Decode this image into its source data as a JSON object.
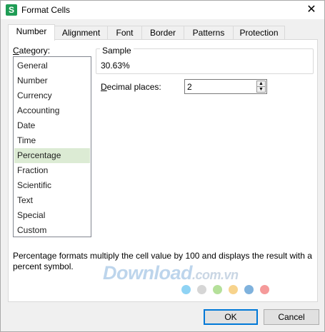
{
  "window": {
    "title": "Format Cells",
    "close_glyph": "✕",
    "app_icon_letter": "S"
  },
  "tabs": [
    {
      "label": "Number",
      "active": true
    },
    {
      "label": "Alignment",
      "active": false
    },
    {
      "label": "Font",
      "active": false
    },
    {
      "label": "Border",
      "active": false
    },
    {
      "label": "Patterns",
      "active": false
    },
    {
      "label": "Protection",
      "active": false
    }
  ],
  "category": {
    "label_prefix": "C",
    "label_rest": "ategory:",
    "items": [
      "General",
      "Number",
      "Currency",
      "Accounting",
      "Date",
      "Time",
      "Percentage",
      "Fraction",
      "Scientific",
      "Text",
      "Special",
      "Custom"
    ],
    "selected": "Percentage"
  },
  "sample": {
    "legend": "Sample",
    "value": "30.63%"
  },
  "decimal_places": {
    "label_prefix": "D",
    "label_rest": "ecimal places:",
    "value": "2",
    "up_glyph": "▲",
    "down_glyph": "▼"
  },
  "description": "Percentage formats multiply the cell value by 100 and displays the result with a percent symbol.",
  "watermark": {
    "main": "Download",
    "suffix": ".com.vn"
  },
  "watermark_dots": [
    "#8fd3f4",
    "#d6d6d6",
    "#b5e09a",
    "#f7d38c",
    "#7fb2dd",
    "#f59a9a"
  ],
  "buttons": {
    "ok": "OK",
    "cancel": "Cancel"
  },
  "colors": {
    "selected_bg": "#dcebd4",
    "accent": "#0078d7",
    "app_icon": "#1f9d55"
  }
}
